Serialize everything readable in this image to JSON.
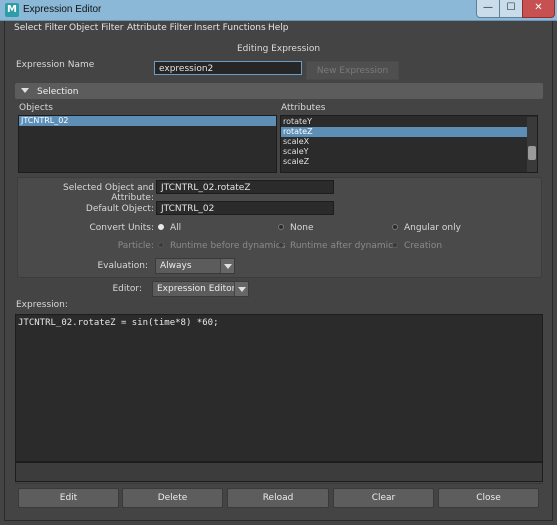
{
  "window": {
    "title": "Expression Editor",
    "app_icon": "M",
    "controls": {
      "minimize": "—",
      "maximize": "☐",
      "close": "✕"
    }
  },
  "menu": [
    "Select Filter",
    "Object Filter",
    "Attribute Filter",
    "Insert Functions",
    "Help"
  ],
  "mode_label": "Editing Expression",
  "expression_name": {
    "label": "Expression Name",
    "value": "expression2",
    "new_button": "New Expression"
  },
  "selection": {
    "header": "Selection",
    "objects_label": "Objects",
    "objects": [
      {
        "label": "JTCNTRL_02",
        "selected": true
      }
    ],
    "attributes_label": "Attributes",
    "attributes": [
      {
        "label": "rotateY",
        "selected": false
      },
      {
        "label": "rotateZ",
        "selected": true
      },
      {
        "label": "scaleX",
        "selected": false
      },
      {
        "label": "scaleY",
        "selected": false
      },
      {
        "label": "scaleZ",
        "selected": false
      }
    ]
  },
  "form": {
    "selected_obj_attr_label": "Selected Object and Attribute:",
    "selected_obj_attr_value": "JTCNTRL_02.rotateZ",
    "default_object_label": "Default Object:",
    "default_object_value": "JTCNTRL_02",
    "convert_units_label": "Convert Units:",
    "convert_units_options": [
      "All",
      "None",
      "Angular only"
    ],
    "convert_units_selected": "All",
    "particle_label": "Particle:",
    "particle_options": [
      "Runtime before dynamics",
      "Runtime after dynamics",
      "Creation"
    ],
    "evaluation_label": "Evaluation:",
    "evaluation_value": "Always",
    "editor_label": "Editor:",
    "editor_value": "Expression Editor"
  },
  "expression": {
    "label": "Expression:",
    "code": "JTCNTRL_02.rotateZ = sin(time*8) *60;"
  },
  "buttons": [
    "Edit",
    "Delete",
    "Reload",
    "Clear",
    "Close"
  ],
  "colors": {
    "selection_highlight": "#5d8fb6",
    "titlebar": "#8cb8d8",
    "background": "#444444"
  }
}
